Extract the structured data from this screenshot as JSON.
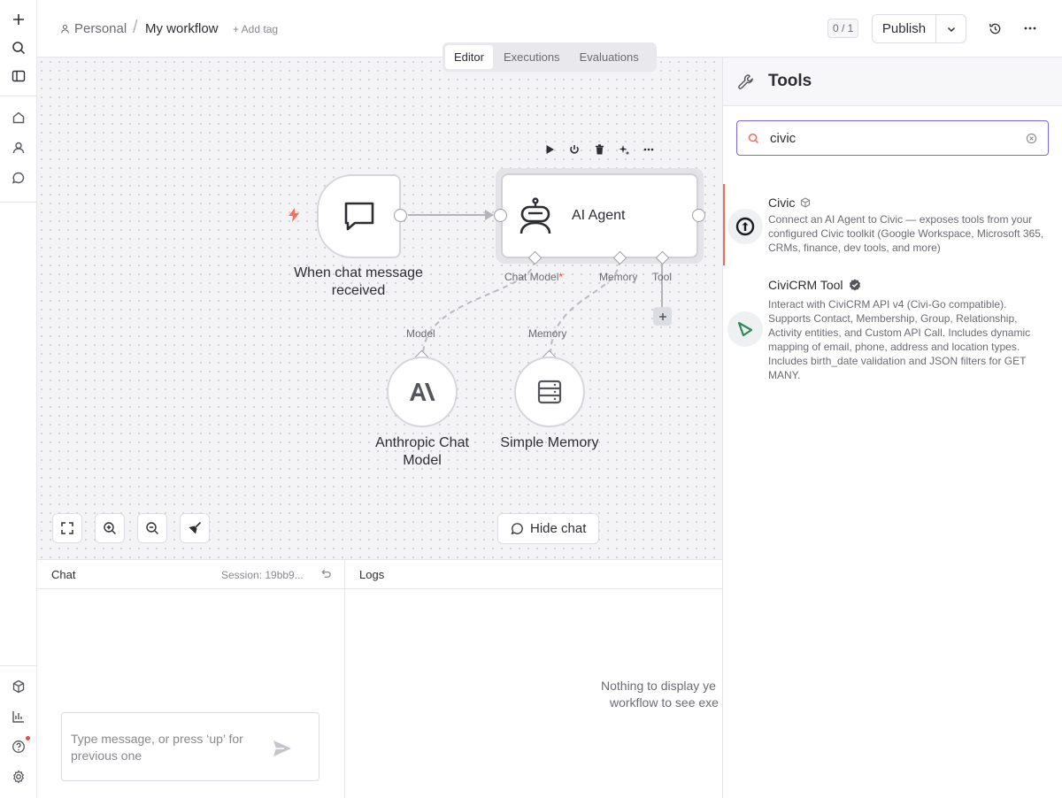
{
  "header": {
    "project": "Personal",
    "separator": "/",
    "workflow_name": "My workflow",
    "add_tag": "+ Add tag",
    "counter": "0 / 1",
    "publish_label": "Publish"
  },
  "tabs": [
    {
      "label": "Editor",
      "active": true
    },
    {
      "label": "Executions",
      "active": false
    },
    {
      "label": "Evaluations",
      "active": false
    }
  ],
  "canvas": {
    "trigger_node": {
      "label": "When chat message received"
    },
    "agent_node": {
      "label": "AI Agent"
    },
    "ports": {
      "chat_model": "Chat Model",
      "required_mark": "*",
      "memory": "Memory",
      "tool": "Tool"
    },
    "model_node": {
      "port_label": "Model",
      "label": "Anthropic Chat Model"
    },
    "memory_node": {
      "port_label": "Memory",
      "label": "Simple Memory"
    },
    "hide_chat_label": "Hide chat"
  },
  "chat_panel": {
    "title": "Chat",
    "session": "Session: 19bb9...",
    "input_placeholder": "Type message, or press ‘up’ for previous one"
  },
  "logs_panel": {
    "title": "Logs",
    "empty_line1": "Nothing to display ye",
    "empty_line2": "workflow to see exe"
  },
  "tools_panel": {
    "title": "Tools",
    "search_value": "civic",
    "results": [
      {
        "name": "Civic",
        "description": "Connect an AI Agent to Civic — exposes tools from your configured Civic toolkit (Google Workspace, Microsoft 365, CRMs, finance, dev tools, and more)"
      },
      {
        "name": "CiviCRM Tool",
        "description": "Interact with CiviCRM API v4 (Civi-Go compatible). Supports Contact, Membership, Group, Relationship, Activity entities, and Custom API Call. Includes dynamic mapping of email, phone, address and location types. Includes birth_date validation and JSON filters for GET MANY."
      }
    ]
  },
  "colors": {
    "accent": "#7b68ee",
    "highlight_bar": "#ef6a5a",
    "trigger_bolt": "#ff6d5a",
    "notification_dot": "#e74c3c"
  },
  "icons": [
    "plus-icon",
    "search-icon",
    "sidebar-toggle-icon",
    "home-icon",
    "user-icon",
    "chat-bubble-icon",
    "cube-icon",
    "chart-icon",
    "help-icon",
    "settings-icon",
    "history-icon",
    "more-icon",
    "wrench-icon",
    "robot-icon",
    "anthropic-icon",
    "database-icon"
  ]
}
